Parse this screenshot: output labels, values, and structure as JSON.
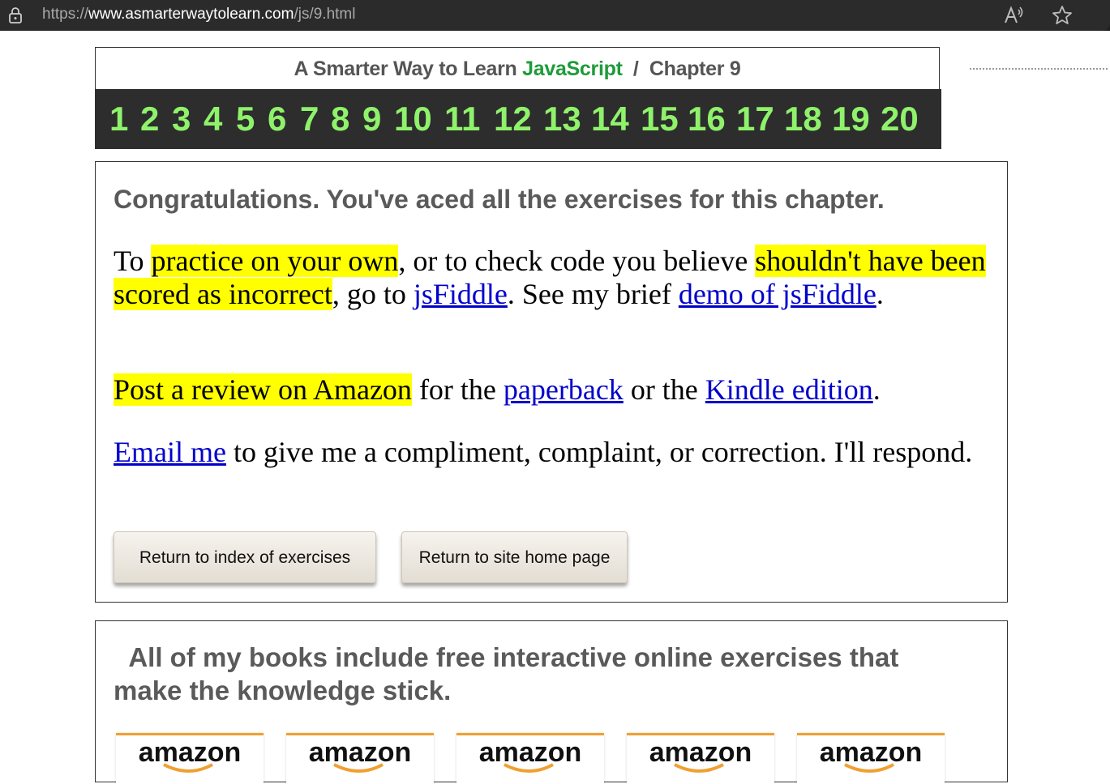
{
  "browser": {
    "url_prefix": "https://",
    "url_domain": "www.asmarterwaytolearn.com",
    "url_path": "/js/9.html"
  },
  "header": {
    "title_prefix": "A Smarter Way to Learn",
    "title_brand": "JavaScript",
    "separator": "/",
    "chapter": "Chapter 9",
    "chapters": [
      "1",
      "2",
      "3",
      "4",
      "5",
      "6",
      "7",
      "8",
      "9",
      "10",
      "11",
      "12",
      "13",
      "14",
      "15",
      "16",
      "17",
      "18",
      "19",
      "20"
    ]
  },
  "main": {
    "congrats": "Congratulations. You've aced all the exercises for this chapter.",
    "p1": {
      "t1": "To ",
      "h1": "practice on your own",
      "t2": ", or to check code you believe ",
      "h2": "shouldn't have been scored as incorrect",
      "t3": ", go to ",
      "l1": "jsFiddle",
      "t4": ". See my brief ",
      "l2": "demo of jsFiddle",
      "t5": "."
    },
    "p2": {
      "h1": "Post a review on Amazon",
      "t1": " for the ",
      "l1": "paperback",
      "t2": " or the ",
      "l2": "Kindle edition",
      "t3": "."
    },
    "p3": {
      "l1": "Email me",
      "t1": " to give me a compliment, complaint, or correction. I'll respond."
    },
    "btn_index": "Return to index of exercises",
    "btn_home": "Return to site home page"
  },
  "books": {
    "heading": "All of my books include free interactive online exercises that make the knowledge stick.",
    "amazon_label": "amazon",
    "badges": [
      "amazon",
      "amazon",
      "amazon",
      "amazon",
      "amazon"
    ]
  },
  "colors": {
    "brand_green": "#1e9b3a",
    "chapter_green": "#8ff26b",
    "highlight": "#ffff00",
    "link": "#0000cc"
  }
}
